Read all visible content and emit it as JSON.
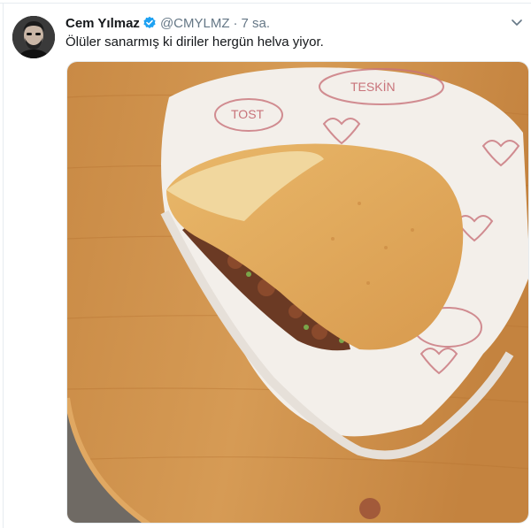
{
  "tweet": {
    "author_name": "Cem Yılmaz",
    "author_handle": "@CMYLMZ",
    "separator": "·",
    "timestamp": "7 sa.",
    "text": "Ölüler sanarmış ki diriler hergün helva yiyor."
  },
  "icons": {
    "verified": "verified-badge-icon",
    "menu": "chevron-down-icon"
  },
  "colors": {
    "verified_blue": "#1da1f2",
    "text_primary": "#14171a",
    "text_secondary": "#657786"
  },
  "media": {
    "wrapper_text_1": "TESKİN",
    "wrapper_text_2": "TOST"
  }
}
